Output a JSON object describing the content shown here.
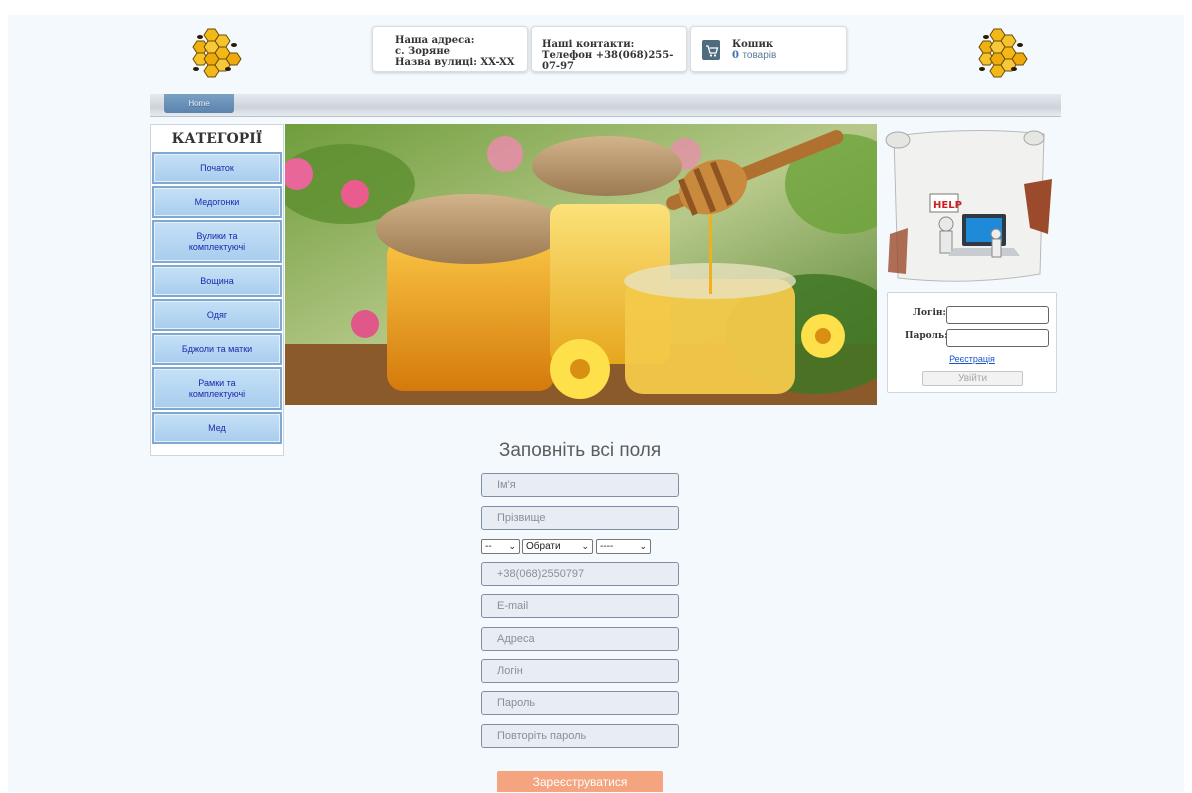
{
  "header": {
    "address_title": "Наша адреса:",
    "address_village": "с. Зоряне",
    "address_street": "Назва вулиці: XX-XX",
    "contacts_title": "Наші контакти:",
    "contacts_phone": "Телефон +38(068)255-07-97",
    "cart_title": "Кошик",
    "cart_count": "0",
    "cart_unit": "товарів"
  },
  "nav": {
    "home_label": "Home"
  },
  "categories": {
    "title": "КАТЕГОРІЇ",
    "items": [
      {
        "label": "Початок"
      },
      {
        "label": "Медогонки"
      },
      {
        "label": "Вулики та комплектуючі"
      },
      {
        "label": "Вощина"
      },
      {
        "label": "Одяг"
      },
      {
        "label": "Бджоли та матки"
      },
      {
        "label": "Рамки та комплектуючі"
      },
      {
        "label": "Мед"
      }
    ]
  },
  "help": {
    "sign_text": "HELP"
  },
  "login": {
    "login_label": "Логін:",
    "password_label": "Пароль:",
    "register_link": "Реєстрація",
    "enter_button": "Увійти"
  },
  "form": {
    "title": "Заповніть всі поля",
    "first_name_placeholder": "Ім'я",
    "last_name_placeholder": "Прізвище",
    "day_select": "--",
    "month_select": "Обрати",
    "year_select": "----",
    "phone_placeholder": "+38(068)2550797",
    "email_placeholder": "E-mail",
    "address_placeholder": "Адреса",
    "login_placeholder": "Логін",
    "password_placeholder": "Пароль",
    "repeat_password_placeholder": "Повторіть пароль",
    "submit_label": "Зареєструватися"
  },
  "colors": {
    "page_background": "#f3f9fd",
    "category_button": "#b5d6f2",
    "category_text": "#1c28b0",
    "submit_button": "#f4a47e",
    "link": "#1a55c8"
  },
  "icons": {
    "logo": "honeycomb-bees-logo",
    "cart": "shopping-cart-icon"
  }
}
